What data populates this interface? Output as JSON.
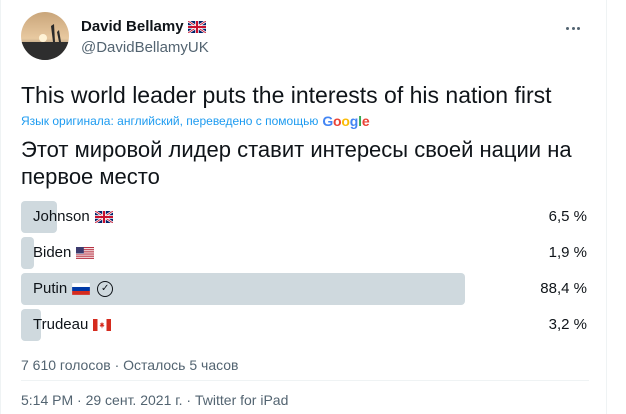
{
  "author": {
    "display_name": "David Bellamy",
    "handle": "@DavidBellamyUK",
    "flag_icon": "uk-flag-icon"
  },
  "tweet": {
    "text": "This world leader puts the interests of his nation first",
    "translation_note": "Язык оригинала: английский, переведено с помощью",
    "translation_provider": "Google",
    "translated_text": "Этот мировой лидер ставит интересы своей нации на первое место"
  },
  "poll": {
    "options": [
      {
        "label": "Johnson",
        "flag": "uk-flag-icon",
        "percent_text": "6,5 %",
        "fraction": 0.065,
        "winner": false
      },
      {
        "label": "Biden",
        "flag": "us-flag-icon",
        "percent_text": "1,9 %",
        "fraction": 0.019,
        "winner": false
      },
      {
        "label": "Putin",
        "flag": "russia-flag-icon",
        "percent_text": "88,4 %",
        "fraction": 0.884,
        "winner": true
      },
      {
        "label": "Trudeau",
        "flag": "canada-flag-icon",
        "percent_text": "3,2 %",
        "fraction": 0.032,
        "winner": false
      }
    ],
    "meta": "7 610 голосов · Осталось 5 часов"
  },
  "footer": {
    "time": "5:14 PM",
    "separator1": " · ",
    "date": "29 сент. 2021 г.",
    "separator2": " · ",
    "source": "Twitter for iPad"
  },
  "colors": {
    "accent": "#1d9bf0",
    "bar": "#cfd9de",
    "muted": "#536471",
    "text": "#0f1419"
  }
}
